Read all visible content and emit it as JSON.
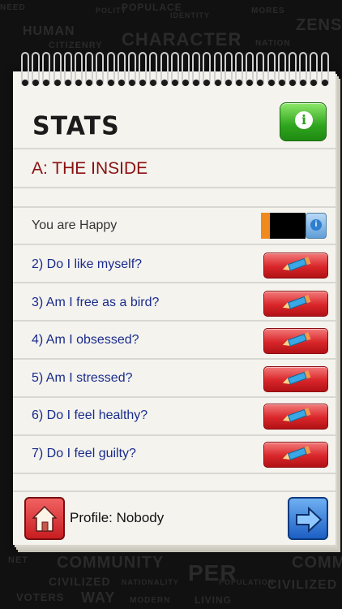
{
  "header": {
    "title": "STATS"
  },
  "section": {
    "title": "A: THE INSIDE"
  },
  "mood": {
    "text": "You are Happy"
  },
  "questions": [
    "2) Do I like myself?",
    "3) Am I free as a bird?",
    "4) Am I obsessed?",
    "5) Am I stressed?",
    "6) Do I feel healthy?",
    "7) Do I feel guilty?"
  ],
  "footer": {
    "profile": "Profile: Nobody"
  },
  "background_words": {
    "top": [
      "NEED",
      "POLITY",
      "POPULACE",
      "IDENTITY",
      "HUMAN",
      "ZENS",
      "CITIZENRY",
      "MORES",
      "CHARACTER",
      "NATION"
    ],
    "bottom": [
      "NET",
      "COMMUNITY",
      "COMMU",
      "CIVILIZED",
      "NATIONALITY",
      "PER",
      "LIVING",
      "POPULATION",
      "VOTERS",
      "WAY",
      "MODERN",
      "CIVILIZED"
    ]
  },
  "colors": {
    "section_title": "#8a1010",
    "question_text": "#1a2c8c",
    "mood_orange": "#f08a1c",
    "info_green": "#2fa51e",
    "edit_red": "#d9262a",
    "next_blue": "#1d5fc4"
  },
  "icons": {
    "info": "info-icon",
    "edit": "pencil-icon",
    "home": "home-icon",
    "next": "arrow-right-icon"
  }
}
